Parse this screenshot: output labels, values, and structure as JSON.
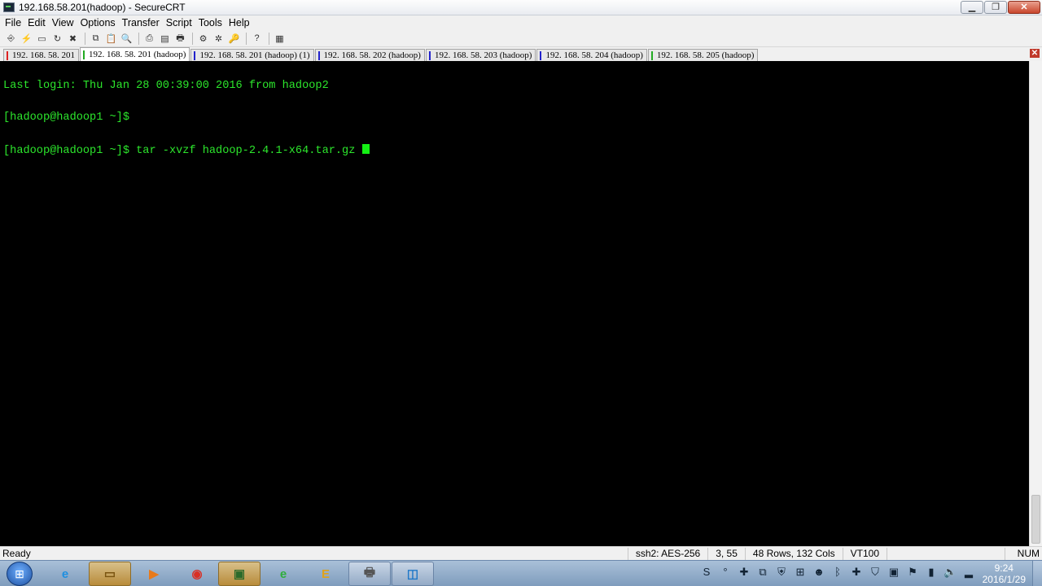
{
  "window": {
    "title": "192.168.58.201(hadoop) - SecureCRT",
    "minimize_label": "▁",
    "restore_label": "❐",
    "close_label": "✕"
  },
  "menu": [
    {
      "label": "File"
    },
    {
      "label": "Edit"
    },
    {
      "label": "View"
    },
    {
      "label": "Options"
    },
    {
      "label": "Transfer"
    },
    {
      "label": "Script"
    },
    {
      "label": "Tools"
    },
    {
      "label": "Help"
    }
  ],
  "toolbar_icons": [
    {
      "name": "connect-icon",
      "glyph": "⎆"
    },
    {
      "name": "quick-connect-icon",
      "glyph": "⚡"
    },
    {
      "name": "connect-in-tab-icon",
      "glyph": "▭"
    },
    {
      "name": "reconnect-icon",
      "glyph": "↻"
    },
    {
      "name": "disconnect-icon",
      "glyph": "✖"
    },
    {
      "name": "copy-icon",
      "glyph": "⧉"
    },
    {
      "name": "paste-icon",
      "glyph": "📋"
    },
    {
      "name": "find-icon",
      "glyph": "🔍"
    },
    {
      "name": "print-setup-icon",
      "glyph": "⎙"
    },
    {
      "name": "print-selection-icon",
      "glyph": "▤"
    },
    {
      "name": "print-icon",
      "glyph": "🖶"
    },
    {
      "name": "session-options-icon",
      "glyph": "⚙"
    },
    {
      "name": "global-options-icon",
      "glyph": "✲"
    },
    {
      "name": "keymap-icon",
      "glyph": "🔑"
    },
    {
      "name": "help-icon",
      "glyph": "?"
    },
    {
      "name": "sftp-icon",
      "glyph": "▦"
    }
  ],
  "tabs": [
    {
      "label": "192. 168. 58. 201",
      "marker": "#d22",
      "active": false
    },
    {
      "label": "192. 168. 58. 201 (hadoop)",
      "marker": "#2a2",
      "active": true
    },
    {
      "label": "192. 168. 58. 201 (hadoop)   (1)",
      "marker": "#22c",
      "active": false
    },
    {
      "label": "192. 168. 58. 202 (hadoop)",
      "marker": "#22c",
      "active": false
    },
    {
      "label": "192. 168. 58. 203 (hadoop)",
      "marker": "#22c",
      "active": false
    },
    {
      "label": "192. 168. 58. 204 (hadoop)",
      "marker": "#22c",
      "active": false
    },
    {
      "label": "192. 168. 58. 205 (hadoop)",
      "marker": "#2a2",
      "active": false
    }
  ],
  "tab_close_label": "✕",
  "terminal": {
    "lines": [
      "Last login: Thu Jan 28 00:39:00 2016 from hadoop2",
      "[hadoop@hadoop1 ~]$ ",
      "[hadoop@hadoop1 ~]$ tar -xvzf hadoop-2.4.1-x64.tar.gz "
    ],
    "text_color": "#2ce62c",
    "cursor_color": "#14f014"
  },
  "status": {
    "ready": "Ready",
    "cipher": "ssh2: AES-256",
    "position": "3,  55",
    "size": "48 Rows, 132 Cols",
    "emulation": "VT100",
    "num": "NUM"
  },
  "taskbar": {
    "start_glyph": "⊞",
    "apps": [
      {
        "name": "ie-taskbar-icon",
        "glyph": "e",
        "style": "pinned",
        "color": "#1e8fe0"
      },
      {
        "name": "explorer-taskbar-icon",
        "glyph": "▭",
        "style": "running",
        "color": "#7a5410"
      },
      {
        "name": "media-player-taskbar-icon",
        "glyph": "▶",
        "style": "pinned",
        "color": "#e87a1a"
      },
      {
        "name": "chrome-taskbar-icon",
        "glyph": "◉",
        "style": "pinned",
        "color": "#d93025"
      },
      {
        "name": "securecrt-taskbar-icon",
        "glyph": "▣",
        "style": "running",
        "color": "#2a6a2a"
      },
      {
        "name": "360-browser-taskbar-icon",
        "glyph": "e",
        "style": "pinned",
        "color": "#2fae3b"
      },
      {
        "name": "e-app-taskbar-icon",
        "glyph": "E",
        "style": "pinned",
        "color": "#e0a21a"
      },
      {
        "name": "printer-taskbar-icon",
        "glyph": "🖶",
        "style": "running2",
        "color": "#555"
      },
      {
        "name": "vmware-taskbar-icon",
        "glyph": "◫",
        "style": "running2",
        "color": "#1f78c8"
      }
    ],
    "tray": [
      {
        "name": "sogou-tray-icon",
        "glyph": "S"
      },
      {
        "name": "pinyin-tray-icon",
        "glyph": "°"
      },
      {
        "name": "input-tray-icon",
        "glyph": "✚"
      },
      {
        "name": "network-share-tray-icon",
        "glyph": "⧉"
      },
      {
        "name": "shield-tray-icon",
        "glyph": "⛨"
      },
      {
        "name": "windows-tray-icon",
        "glyph": "⊞"
      },
      {
        "name": "qq-tray-icon",
        "glyph": "☻"
      },
      {
        "name": "bluetooth-tray-icon",
        "glyph": "ᛒ"
      },
      {
        "name": "plus-tray-icon",
        "glyph": "✚"
      },
      {
        "name": "security-tray-icon",
        "glyph": "⛉"
      },
      {
        "name": "monitor-tray-icon",
        "glyph": "▣"
      },
      {
        "name": "flag-tray-icon",
        "glyph": "⚑"
      },
      {
        "name": "power-tray-icon",
        "glyph": "▮"
      },
      {
        "name": "volume-tray-icon",
        "glyph": "🔈"
      },
      {
        "name": "signal-tray-icon",
        "glyph": "▂"
      }
    ],
    "time": "9:24",
    "date": "2016/1/29"
  }
}
